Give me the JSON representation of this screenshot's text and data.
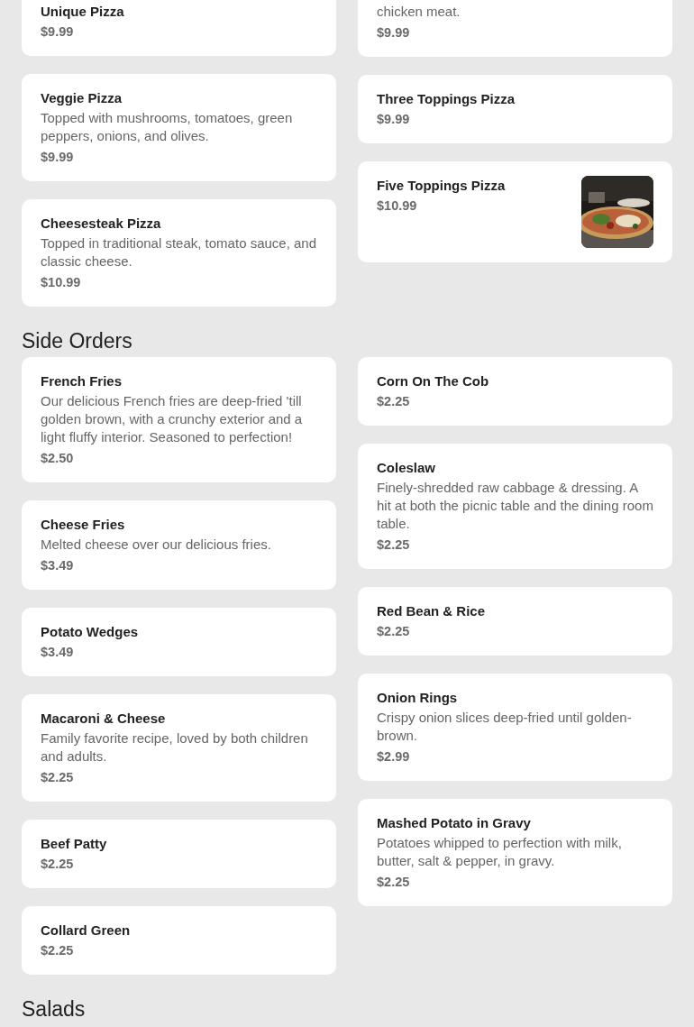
{
  "sections": [
    {
      "columns": [
        [
          {
            "name": "Unique Pizza",
            "price": "$9.99"
          },
          {
            "name": "Veggie Pizza",
            "description": "Topped with mushrooms, tomatoes, green peppers, onions, and olives.",
            "price": "$9.99"
          },
          {
            "name": "Cheesesteak Pizza",
            "description": "Topped in traditional steak, tomato sauce, and classic cheese.",
            "price": "$10.99"
          }
        ],
        [
          {
            "description": "chicken meat.",
            "price": "$9.99"
          },
          {
            "name": "Three Toppings Pizza",
            "price": "$9.99"
          },
          {
            "name": "Five Toppings Pizza",
            "price": "$10.99"
          }
        ]
      ]
    },
    {
      "title": "Side Orders",
      "columns": [
        [
          {
            "name": "French Fries",
            "description": "Our delicious French fries are deep-fried 'till golden brown, with a crunchy exterior and a light fluffy interior. Seasoned to perfection!",
            "price": "$2.50"
          },
          {
            "name": "Cheese Fries",
            "description": "Melted cheese over our delicious fries.",
            "price": "$3.49"
          },
          {
            "name": "Potato Wedges",
            "price": "$3.49"
          },
          {
            "name": "Macaroni & Cheese",
            "description": "Family favorite recipe, loved by both children and adults.",
            "price": "$2.25"
          },
          {
            "name": "Beef Patty",
            "price": "$2.25"
          },
          {
            "name": "Collard Green",
            "price": "$2.25"
          }
        ],
        [
          {
            "name": "Corn On The Cob",
            "price": "$2.25"
          },
          {
            "name": "Coleslaw",
            "description": "Finely-shredded raw cabbage & dressing. A hit at both the picnic table and the dining room table.",
            "price": "$2.25"
          },
          {
            "name": "Red Bean & Rice",
            "price": "$2.25"
          },
          {
            "name": "Onion Rings",
            "description": "Crispy onion slices deep-fried until golden-brown.",
            "price": "$2.99"
          },
          {
            "name": "Mashed Potato in Gravy",
            "description": "Potatoes whipped to perfection with milk, butter, salt & pepper, in gravy.",
            "price": "$2.25"
          }
        ]
      ]
    },
    {
      "title": "Salads",
      "columns": [
        [],
        []
      ]
    }
  ]
}
